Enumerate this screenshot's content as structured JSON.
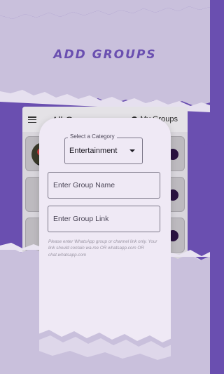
{
  "header": {
    "title": "ADD GROUPS"
  },
  "background_app": {
    "title": "All Groups",
    "action_label": "My Groups"
  },
  "dialog": {
    "category": {
      "label": "Select a Category",
      "value": "Entertainment"
    },
    "group_name": {
      "value": "",
      "placeholder": "Enter Group Name"
    },
    "group_link": {
      "value": "",
      "placeholder": "Enter Group Link"
    },
    "helper_text": "Please enter WhatsApp group or channel link only. Your link should contain wa.me OR whatsapp.com OR chat.whatsapp.com"
  },
  "colors": {
    "brand_purple": "#6a4fb0",
    "paper_light": "#c9c0dc",
    "dialog_bg": "#efe9f5"
  },
  "icons": {
    "menu": "hamburger-menu-icon",
    "dropdown": "chevron-down-icon"
  }
}
